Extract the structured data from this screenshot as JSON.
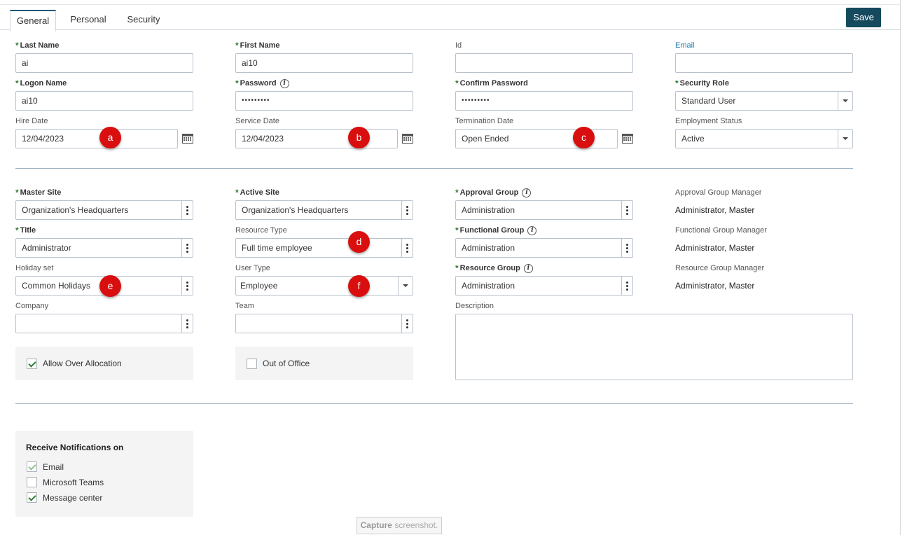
{
  "tabs": [
    "General",
    "Personal",
    "Security"
  ],
  "save_label": "Save",
  "fields": {
    "last_name": {
      "label": "Last Name",
      "value": "ai"
    },
    "first_name": {
      "label": "First Name",
      "value": "ai10"
    },
    "id": {
      "label": "Id",
      "value": ""
    },
    "email": {
      "label": "Email",
      "value": ""
    },
    "logon_name": {
      "label": "Logon Name",
      "value": "ai10"
    },
    "password": {
      "label": "Password",
      "value": "•••••••••"
    },
    "confirm_password": {
      "label": "Confirm Password",
      "value": "•••••••••"
    },
    "security_role": {
      "label": "Security Role",
      "value": "Standard User"
    },
    "hire_date": {
      "label": "Hire Date",
      "value": "12/04/2023"
    },
    "service_date": {
      "label": "Service Date",
      "value": "12/04/2023"
    },
    "termination_date": {
      "label": "Termination Date",
      "value": "Open Ended"
    },
    "employment_status": {
      "label": "Employment Status",
      "value": "Active"
    },
    "master_site": {
      "label": "Master Site",
      "value": "Organization's Headquarters"
    },
    "active_site": {
      "label": "Active Site",
      "value": "Organization's Headquarters"
    },
    "approval_group": {
      "label": "Approval Group",
      "value": "Administration"
    },
    "approval_group_manager": {
      "label": "Approval Group Manager",
      "value": "Administrator, Master"
    },
    "title": {
      "label": "Title",
      "value": "Administrator"
    },
    "resource_type": {
      "label": "Resource Type",
      "value": "Full time employee"
    },
    "functional_group": {
      "label": "Functional Group",
      "value": "Administration"
    },
    "functional_group_manager": {
      "label": "Functional Group Manager",
      "value": "Administrator, Master"
    },
    "holiday_set": {
      "label": "Holiday set",
      "value": "Common Holidays"
    },
    "user_type": {
      "label": "User Type",
      "value": "Employee"
    },
    "resource_group": {
      "label": "Resource Group",
      "value": "Administration"
    },
    "resource_group_manager": {
      "label": "Resource Group Manager",
      "value": "Administrator, Master"
    },
    "company": {
      "label": "Company",
      "value": ""
    },
    "team": {
      "label": "Team",
      "value": ""
    },
    "description": {
      "label": "Description",
      "value": ""
    }
  },
  "info_glyph": "i",
  "required_marker": "*",
  "allow_over_allocation": {
    "label": "Allow Over Allocation",
    "checked": true
  },
  "out_of_office": {
    "label": "Out of Office",
    "checked": false
  },
  "notifications": {
    "title": "Receive Notifications on",
    "items": [
      {
        "label": "Email",
        "checked": true,
        "disabled": true
      },
      {
        "label": "Microsoft Teams",
        "checked": false
      },
      {
        "label": "Message center",
        "checked": true
      }
    ]
  },
  "markers": [
    "a",
    "b",
    "c",
    "d",
    "e",
    "f"
  ],
  "capture": {
    "bold": "Capture",
    "rest": " screenshot."
  },
  "colors": {
    "accent": "#15495e",
    "required": "#2e7d32",
    "marker": "#d90f0f",
    "link": "#1f7aa8"
  }
}
